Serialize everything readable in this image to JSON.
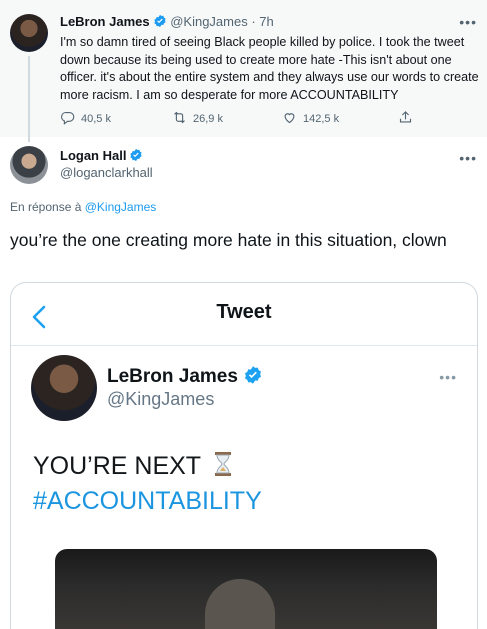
{
  "parent_tweet": {
    "author_name": "LeBron James",
    "handle_time": "@KingJames · 7h",
    "text": "I'm so damn tired of seeing Black people killed by police. I took the tweet down because its being used to create more hate -This isn't about one officer.  it's about the entire system and they always use our words to create more racism. I am so desperate for more ACCOUNTABILITY",
    "replies": "40,5 k",
    "retweets": "26,9 k",
    "likes": "142,5 k",
    "more_icon": "more-horizontal-icon"
  },
  "reply_tweet": {
    "author_name": "Logan Hall",
    "handle": "@loganclarkhall",
    "reply_prefix": "En réponse à",
    "reply_to": "@KingJames",
    "text": "you’re the one creating more hate in this situation, clown"
  },
  "embedded_screenshot": {
    "header_title": "Tweet",
    "author_name": "LeBron James",
    "handle": "@KingJames",
    "line1": "YOU’RE NEXT",
    "line2": "#ACCOUNTABILITY"
  },
  "colors": {
    "accent": "#1d9bf0",
    "muted": "#536471",
    "parent_bg": "#f7f9f9"
  }
}
